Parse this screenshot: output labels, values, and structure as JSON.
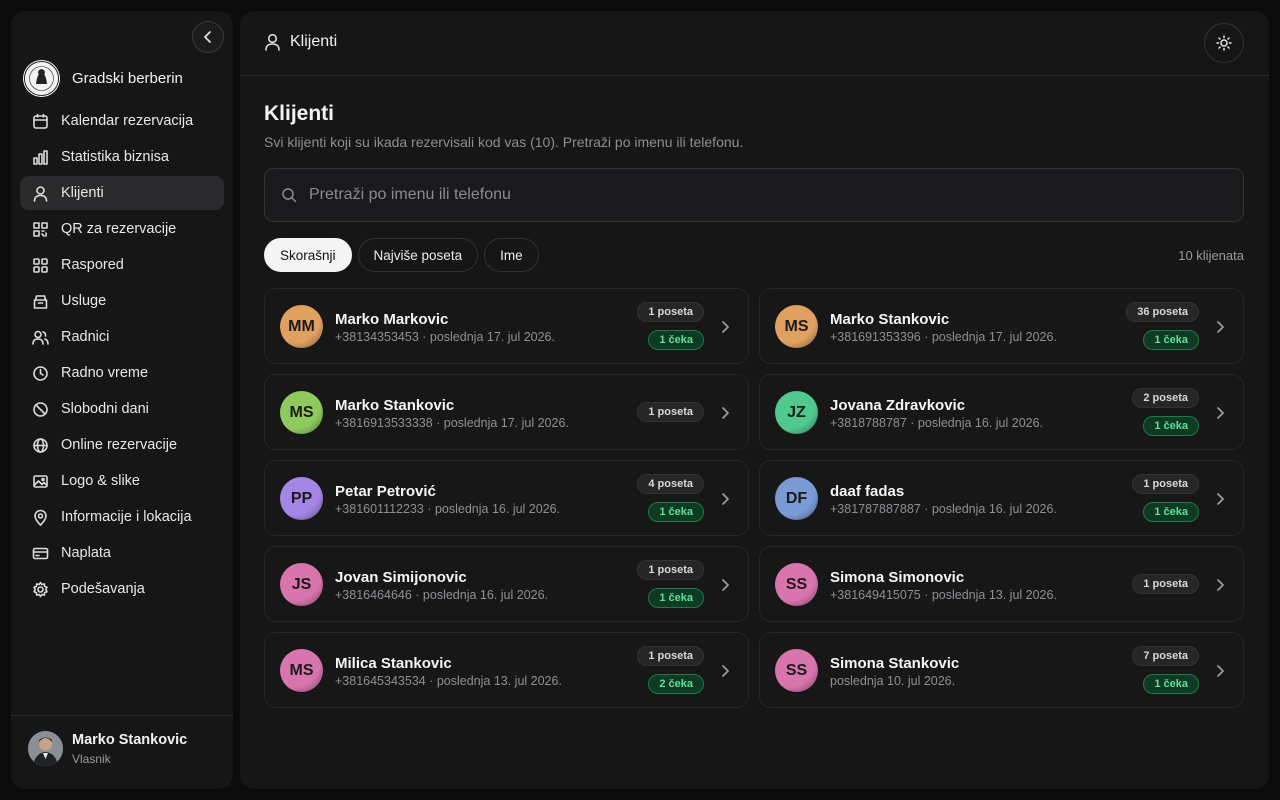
{
  "brand": {
    "name": "Gradski berberin"
  },
  "nav": [
    {
      "label": "Kalendar rezervacija",
      "icon": "calendar-icon"
    },
    {
      "label": "Statistika biznisa",
      "icon": "bar-chart-icon"
    },
    {
      "label": "Klijenti",
      "icon": "user-icon",
      "active": true
    },
    {
      "label": "QR za rezervacije",
      "icon": "qr-code-icon"
    },
    {
      "label": "Raspored",
      "icon": "grid-icon"
    },
    {
      "label": "Usluge",
      "icon": "box-icon"
    },
    {
      "label": "Radnici",
      "icon": "users-icon"
    },
    {
      "label": "Radno vreme",
      "icon": "clock-icon"
    },
    {
      "label": "Slobodni dani",
      "icon": "ban-icon"
    },
    {
      "label": "Online rezervacije",
      "icon": "globe-icon"
    },
    {
      "label": "Logo & slike",
      "icon": "image-icon"
    },
    {
      "label": "Informacije i lokacija",
      "icon": "map-pin-icon"
    },
    {
      "label": "Naplata",
      "icon": "credit-card-icon"
    },
    {
      "label": "Podešavanja",
      "icon": "gear-icon"
    }
  ],
  "user": {
    "name": "Marko Stankovic",
    "role": "Vlasnik"
  },
  "header": {
    "title": "Klijenti"
  },
  "page": {
    "title": "Klijenti",
    "subtitle": "Svi klijenti koji su ikada rezervisali kod vas (10). Pretraži po imenu ili telefonu.",
    "search_placeholder": "Pretraži po imenu ili telefonu",
    "tabs": [
      "Skorašnji",
      "Najviše poseta",
      "Ime"
    ],
    "count_label": "10 klijenata"
  },
  "clients": [
    {
      "initials": "MM",
      "name": "Marko Markovic",
      "meta": "+38134353453 · poslednja 17. jul 2026.",
      "visits": "1 poseta",
      "waiting": "1 čeka",
      "color": "#e0a060"
    },
    {
      "initials": "MS",
      "name": "Marko Stankovic",
      "meta": "+381691353396 · poslednja 17. jul 2026.",
      "visits": "36 poseta",
      "waiting": "1 čeka",
      "color": "#e0a060"
    },
    {
      "initials": "MS",
      "name": "Marko Stankovic",
      "meta": "+3816913533338 · poslednja 17. jul 2026.",
      "visits": "1 poseta",
      "waiting": "",
      "color": "#8fca5e"
    },
    {
      "initials": "JZ",
      "name": "Jovana Zdravkovic",
      "meta": "+3818788787 · poslednja 16. jul 2026.",
      "visits": "2 poseta",
      "waiting": "1 čeka",
      "color": "#4fc98e"
    },
    {
      "initials": "PP",
      "name": "Petar Petrović",
      "meta": "+381601112233 · poslednja 16. jul 2026.",
      "visits": "4 poseta",
      "waiting": "1 čeka",
      "color": "#a486e6"
    },
    {
      "initials": "DF",
      "name": "daaf fadas",
      "meta": "+381787887887 · poslednja 16. jul 2026.",
      "visits": "1 poseta",
      "waiting": "1 čeka",
      "color": "#7a9ad6"
    },
    {
      "initials": "JS",
      "name": "Jovan Simijonovic",
      "meta": "+3816464646 · poslednja 16. jul 2026.",
      "visits": "1 poseta",
      "waiting": "1 čeka",
      "color": "#d975ad"
    },
    {
      "initials": "SS",
      "name": "Simona Simonovic",
      "meta": "+381649415075 · poslednja 13. jul 2026.",
      "visits": "1 poseta",
      "waiting": "",
      "color": "#d975ad"
    },
    {
      "initials": "MS",
      "name": "Milica Stankovic",
      "meta": "+381645343534 · poslednja 13. jul 2026.",
      "visits": "1 poseta",
      "waiting": "2 čeka",
      "color": "#d975ad"
    },
    {
      "initials": "SS",
      "name": "Simona Stankovic",
      "meta": "poslednja 10. jul 2026.",
      "visits": "7 poseta",
      "waiting": "1 čeka",
      "color": "#d975ad"
    }
  ]
}
